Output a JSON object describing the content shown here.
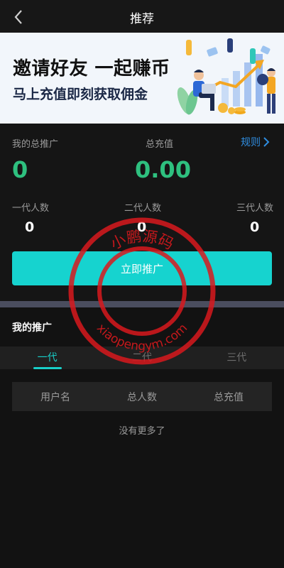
{
  "header": {
    "title": "推荐"
  },
  "banner": {
    "title": "邀请好友 一起赚币",
    "subtitle": "马上充值即刻获取佣金"
  },
  "summary": {
    "total_promo_label": "我的总推广",
    "total_promo_value": "0",
    "total_recharge_label": "总充值",
    "total_recharge_value": "0.00",
    "rules_label": "规则"
  },
  "generations": [
    {
      "label": "一代人数",
      "value": "0"
    },
    {
      "label": "二代人数",
      "value": "0"
    },
    {
      "label": "三代人数",
      "value": "0"
    }
  ],
  "promote_button": "立即推广",
  "my_promo": {
    "title": "我的推广",
    "tabs": [
      "一代",
      "二代",
      "三代"
    ],
    "active_tab": 0,
    "columns": [
      "用户名",
      "总人数",
      "总充值"
    ],
    "empty_text": "没有更多了"
  },
  "watermark": {
    "top_text": "小鹏源码",
    "bottom_text": "xiaopengym.com"
  },
  "colors": {
    "accent": "#16d3cf",
    "green_value": "#2ec07f",
    "link": "#2f8de0",
    "stamp": "#d8191d"
  }
}
